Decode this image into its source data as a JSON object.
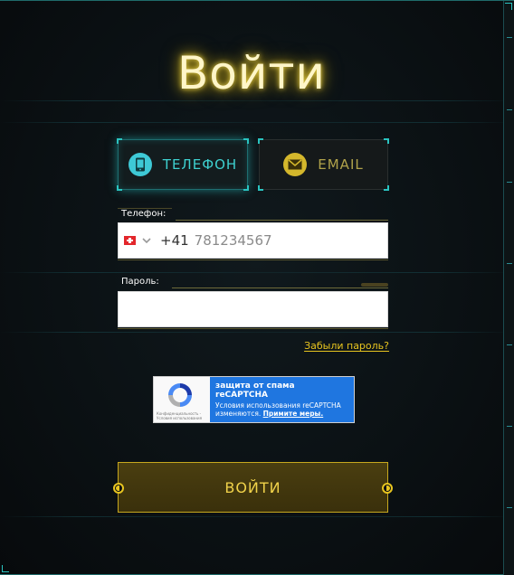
{
  "title": "Войти",
  "tabs": [
    {
      "label": "ТЕЛЕФОН",
      "icon": "phone-icon",
      "active": true
    },
    {
      "label": "EMAIL",
      "icon": "mail-icon",
      "active": false
    }
  ],
  "phone_field": {
    "label": "Телефон:",
    "country_flag": "switzerland-flag-icon",
    "dial_code": "+41",
    "placeholder": "781234567",
    "value": ""
  },
  "password_field": {
    "label": "Пароль:",
    "value": ""
  },
  "forgot_password": "Забыли пароль?",
  "recaptcha": {
    "title": "защита от спама reCAPTCHA",
    "line1": "Условия использования reCAPTCHA",
    "line2_prefix": "изменяются. ",
    "link": "Примите меры.",
    "privacy": "Конфиденциальность - Условия использования"
  },
  "submit_label": "ВОЙТИ",
  "colors": {
    "accent_cyan": "#3ed1d0",
    "accent_gold": "#e8c51f",
    "background": "#0b0f12",
    "recaptcha_blue": "#1f76e0"
  }
}
